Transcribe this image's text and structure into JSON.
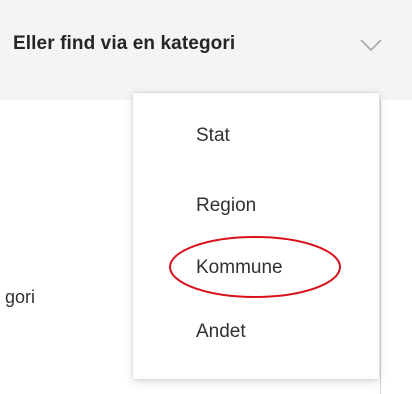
{
  "header": {
    "category_prompt": "Eller find via en kategori",
    "chevron_icon": "chevron-down-icon"
  },
  "body": {
    "partial_text": "gori"
  },
  "menu": {
    "items": [
      {
        "label": "Stat"
      },
      {
        "label": "Region"
      },
      {
        "label": "Kommune"
      },
      {
        "label": "Andet"
      }
    ]
  },
  "annotation": {
    "highlight_color": "#d9111b"
  },
  "colors": {
    "header_background": "#f4f4f4",
    "menu_background": "#ffffff",
    "text": "#323130"
  }
}
